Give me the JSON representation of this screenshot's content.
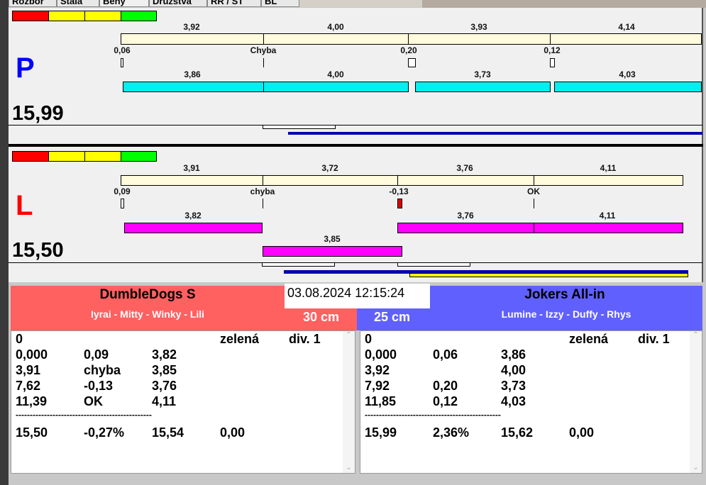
{
  "tabs": [
    "Rozbor",
    "Stala",
    "Běhy",
    "Družstva",
    "RR / ST",
    "BL"
  ],
  "colors": {
    "red": "#ff0000",
    "yellow": "#ffff00",
    "green": "#00ff00",
    "cyan": "#00f0f0",
    "magenta": "#ff00ff",
    "team_left": "#ff6060",
    "team_right": "#6060ff"
  },
  "lanes": {
    "p": {
      "letter": "P",
      "total": "15,99",
      "top": [
        "3,92",
        "4,00",
        "3,93",
        "4,14"
      ],
      "mid": [
        "0,06",
        "Chyba",
        "0,20",
        "0,12"
      ],
      "bottom": [
        "3,86",
        "4,00",
        "3,73",
        "4,03"
      ]
    },
    "l": {
      "letter": "L",
      "total": "15,50",
      "top": [
        "3,91",
        "3,72",
        "3,76",
        "4,11"
      ],
      "mid": [
        "0,09",
        "chyba",
        "-0,13",
        "OK"
      ],
      "bottom": [
        "3,82",
        "3,76",
        "4,11"
      ],
      "rerun": "3,85"
    }
  },
  "datetime": "03.08.2024 12:15:24",
  "teams": {
    "left": {
      "name": "DumbleDogs S",
      "members": "Iyrai - Mitty - Winky - Lili",
      "distance": "30 cm",
      "rows": [
        [
          "0",
          "",
          "",
          "zelená",
          "div. 1"
        ],
        [
          "0,000",
          "0,09",
          "3,82",
          "",
          ""
        ],
        [
          "3,91",
          "chyba",
          "3,85",
          "",
          ""
        ],
        [
          "7,62",
          "-0,13",
          "3,76",
          "",
          ""
        ],
        [
          "11,39",
          "OK",
          "4,11",
          "",
          ""
        ]
      ],
      "divider": "------------------------------------------------",
      "totals": [
        "15,50",
        "-0,27%",
        "15,54",
        "0,00"
      ]
    },
    "right": {
      "name": "Jokers All-in",
      "members": "Lumine - Izzy - Duffy - Rhys",
      "distance": "25 cm",
      "rows": [
        [
          "0",
          "",
          "",
          "zelená",
          "div. 1"
        ],
        [
          "0,000",
          "0,06",
          "3,86",
          "",
          ""
        ],
        [
          "3,92",
          "",
          "4,00",
          "",
          ""
        ],
        [
          "7,92",
          "0,20",
          "3,73",
          "",
          ""
        ],
        [
          "11,85",
          "0,12",
          "4,03",
          "",
          ""
        ]
      ],
      "divider": "------------------------------------------------",
      "totals": [
        "15,99",
        "2,36%",
        "15,62",
        "0,00"
      ]
    }
  }
}
